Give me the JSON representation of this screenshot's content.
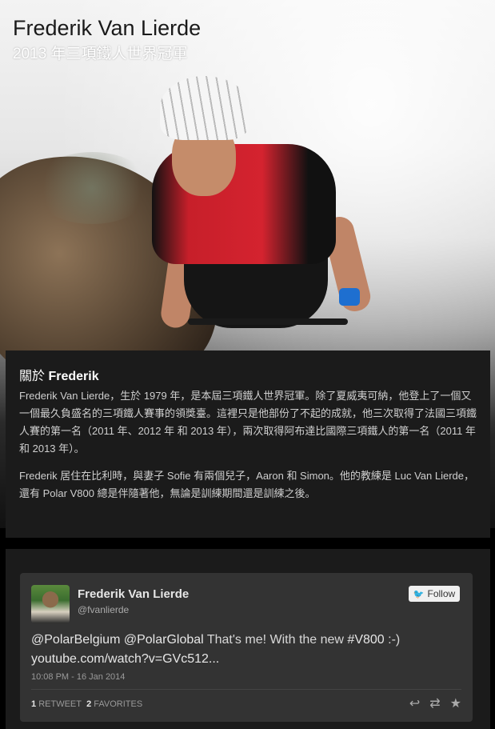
{
  "header": {
    "title": "Frederik Van Lierde",
    "subtitle": "2013 年三項鐵人世界冠軍"
  },
  "about": {
    "heading_prefix": "關於",
    "heading_name": "Frederik",
    "paragraph1": "Frederik Van Lierde，生於 1979 年，是本屆三項鐵人世界冠軍。除了夏威夷可納，他登上了一個又一個最久負盛名的三項鐵人賽事的領獎臺。這裡只是他部份了不起的成就，他三次取得了法國三項鐵人賽的第一名（2011 年、2012 年 和 2013 年），兩次取得阿布達比國際三項鐵人的第一名（2011 年和 2013 年）。",
    "paragraph2": "Frederik 居住在比利時，與妻子 Sofie 有兩個兒子，Aaron 和 Simon。他的教練是 Luc Van Lierde，還有 Polar V800 總是伴隨著他，無論是訓練期間還是訓練之後。"
  },
  "tweet": {
    "user_name": "Frederik Van Lierde",
    "handle": "@fvanlierde",
    "follow_label": "Follow",
    "text_mention1": "@PolarBelgium",
    "text_mention2": "@PolarGlobal",
    "text_body": " That's me! With the new ",
    "text_hashtag": "#V800",
    "text_suffix": " :-)",
    "text_link": "youtube.com/watch?v=GVc512...",
    "timestamp": "10:08 PM - 16 Jan 2014",
    "retweets_count": "1",
    "retweets_label": "RETWEET",
    "favorites_count": "2",
    "favorites_label": "FAVORITES",
    "icons": [
      "reply-icon",
      "retweet-icon",
      "favorite-icon",
      "twitter-bird-icon"
    ]
  }
}
